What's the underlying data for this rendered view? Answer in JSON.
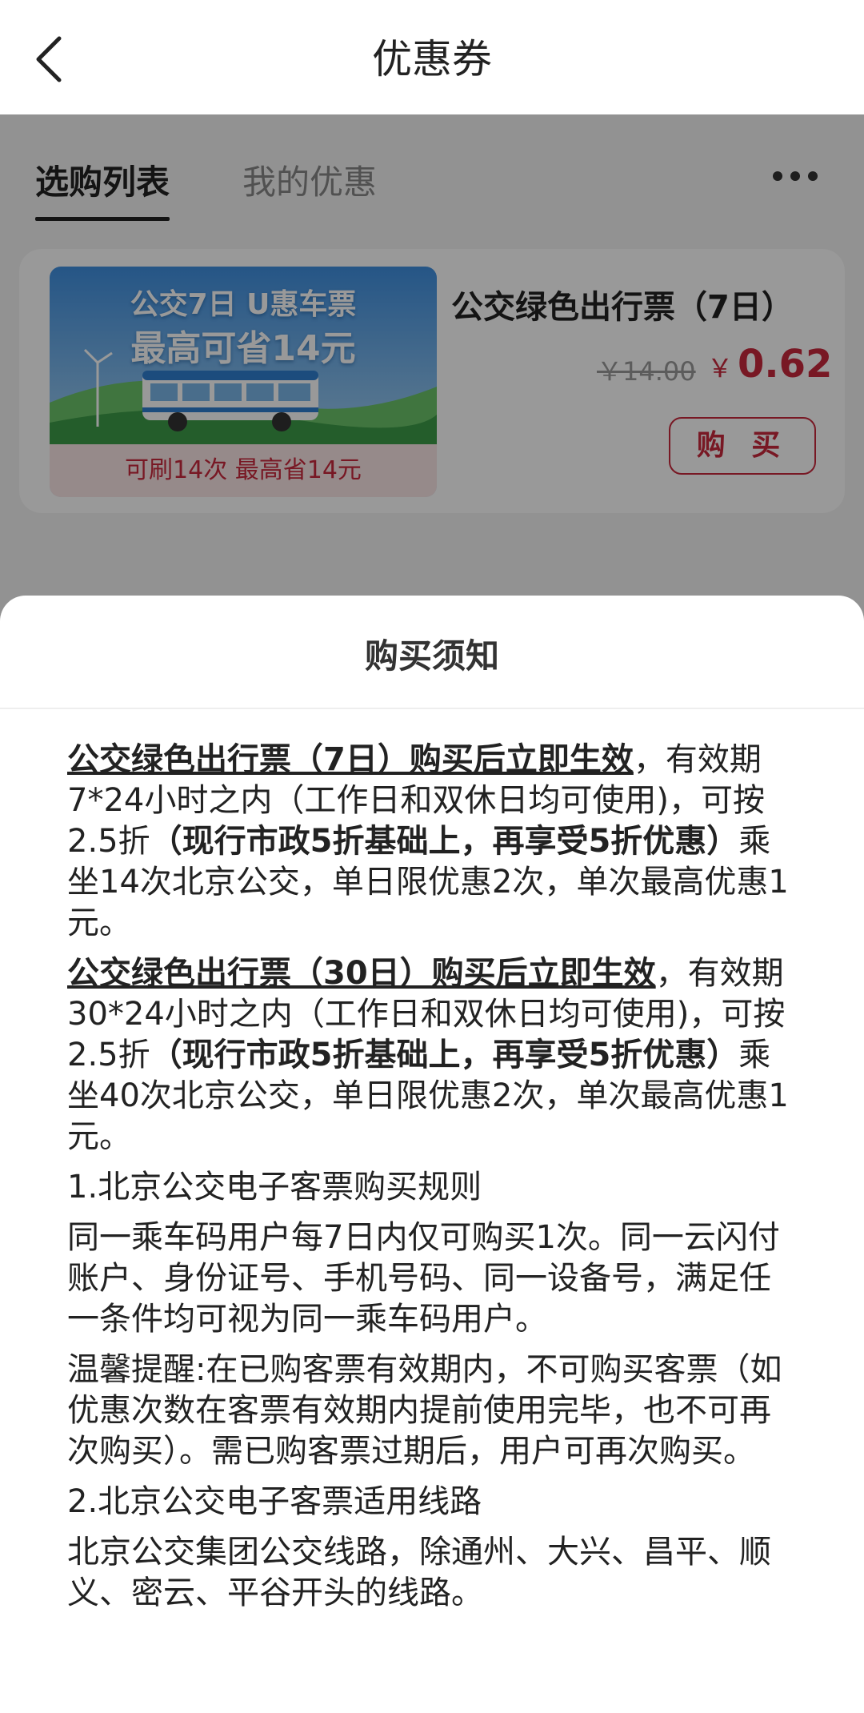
{
  "header": {
    "title": "优惠券",
    "back_icon": "chevron-left-icon"
  },
  "tabs": [
    {
      "label": "选购列表",
      "active": true
    },
    {
      "label": "我的优惠",
      "active": false
    }
  ],
  "more_icon": "more-horizontal-icon",
  "coupon": {
    "image_line1": "公交7日 U惠车票",
    "image_line2": "最高可省14元",
    "image_footer": "可刷14次 最高省14元",
    "name": "公交绿色出行票（7日）",
    "original_price": "￥14.00",
    "currency": "￥",
    "price": "0.62",
    "buy_label": "购 买"
  },
  "colors": {
    "accent": "#c8283c",
    "overlay": "rgba(0,0,0,0.40)"
  },
  "sheet": {
    "title": "购买须知",
    "p1": {
      "underline": "公交绿色出行票（7日）购买后立即生效",
      "t1": "，有效期7*24小时之内（工作日和双休日均可使用)，可按2.5折",
      "bold": "（现行市政5折基础上，再享受5折优惠）",
      "t2": "乘坐14次北京公交，单日限优惠2次，单次最高优惠1元。"
    },
    "p2": {
      "underline": "公交绿色出行票（30日）购买后立即生效",
      "t1": "，有效期30*24小时之内（工作日和双休日均可使用)，可按2.5折",
      "bold": "（现行市政5折基础上，再享受5折优惠）",
      "t2": "乘坐40次北京公交，单日限优惠2次，单次最高优惠1元。"
    },
    "h1": "1.北京公交电子客票购买规则",
    "p3": "同一乘车码用户每7日内仅可购买1次。同一云闪付账户、身份证号、手机号码、同一设备号，满足任一条件均可视为同一乘车码用户。",
    "p4": "温馨提醒:在已购客票有效期内，不可购买客票（如优惠次数在客票有效期内提前使用完毕，也不可再次购买）。需已购客票过期后，用户可再次购买。",
    "h2": "2.北京公交电子客票适用线路",
    "p5": "北京公交集团公交线路，除通州、大兴、昌平、顺义、密云、平谷开头的线路。"
  }
}
